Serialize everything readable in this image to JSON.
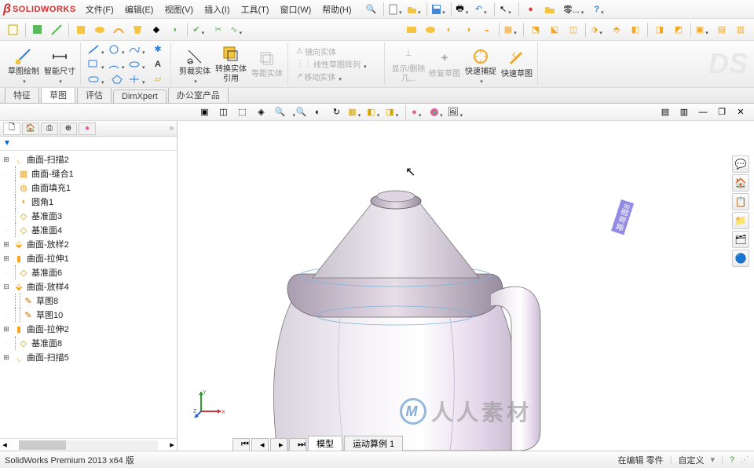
{
  "app": {
    "logo_text": "SOLIDWORKS"
  },
  "menu": {
    "file": "文件(F)",
    "edit": "编辑(E)",
    "view": "视图(V)",
    "insert": "插入(I)",
    "tools": "工具(T)",
    "window": "窗口(W)",
    "help": "帮助(H)"
  },
  "title_tools": {
    "zero": "零...",
    "help_icon": "?"
  },
  "ribbon": {
    "sketch_button": "草图绘制",
    "smart_dim": "智能尺寸",
    "trim": "剪裁实体",
    "convert": "转换实体引用",
    "offset": "等距实体",
    "mirror": "镜向实体",
    "linear_pattern": "线性草图阵列",
    "move": "移动实体",
    "show_delete": "显示/删除几...",
    "repair": "修复草图",
    "quick_snap": "快速捕捉",
    "rapid_sketch": "快速草图"
  },
  "cmd_tabs": {
    "feature": "特征",
    "sketch": "草图",
    "evaluate": "评估",
    "dimxpert": "DimXpert",
    "office": "办公室产品"
  },
  "tree": {
    "items": [
      {
        "toggle": "+",
        "icon": "sweep",
        "label": "曲面-扫描2",
        "indent": 0
      },
      {
        "toggle": "",
        "icon": "knit",
        "label": "曲面-缝合1",
        "indent": 1
      },
      {
        "toggle": "",
        "icon": "fill",
        "label": "曲面填充1",
        "indent": 1
      },
      {
        "toggle": "",
        "icon": "fillet",
        "label": "圆角1",
        "indent": 1
      },
      {
        "toggle": "",
        "icon": "plane",
        "label": "基准面3",
        "indent": 1
      },
      {
        "toggle": "",
        "icon": "plane",
        "label": "基准面4",
        "indent": 1
      },
      {
        "toggle": "+",
        "icon": "loft",
        "label": "曲面-放样2",
        "indent": 0
      },
      {
        "toggle": "+",
        "icon": "extrude",
        "label": "曲面-拉伸1",
        "indent": 0
      },
      {
        "toggle": "",
        "icon": "plane",
        "label": "基准面6",
        "indent": 1
      },
      {
        "toggle": "−",
        "icon": "loft",
        "label": "曲面-放样4",
        "indent": 0
      },
      {
        "toggle": "",
        "icon": "sketch",
        "label": "草图8",
        "indent": 2
      },
      {
        "toggle": "",
        "icon": "sketch",
        "label": "草图10",
        "indent": 2
      },
      {
        "toggle": "+",
        "icon": "extrude",
        "label": "曲面-拉伸2",
        "indent": 0
      },
      {
        "toggle": "",
        "icon": "plane",
        "label": "基准面8",
        "indent": 1
      },
      {
        "toggle": "+",
        "icon": "sweep",
        "label": "曲面-扫描5",
        "indent": 0
      }
    ]
  },
  "viewport": {
    "datum_label": "基准面8",
    "axes": {
      "x": "X",
      "y": "Y",
      "z": "Z"
    }
  },
  "bottom_tabs": {
    "model": "模型",
    "motion": "运动算例 1"
  },
  "watermark": {
    "text": "人人素材",
    "badge": "M"
  },
  "status": {
    "version": "SolidWorks Premium 2013 x64 版",
    "editing": "在编辑 零件",
    "custom": "自定义"
  },
  "taskpane_icons": [
    "💬",
    "🏠",
    "📋",
    "📁",
    "🗂",
    "🔵"
  ]
}
